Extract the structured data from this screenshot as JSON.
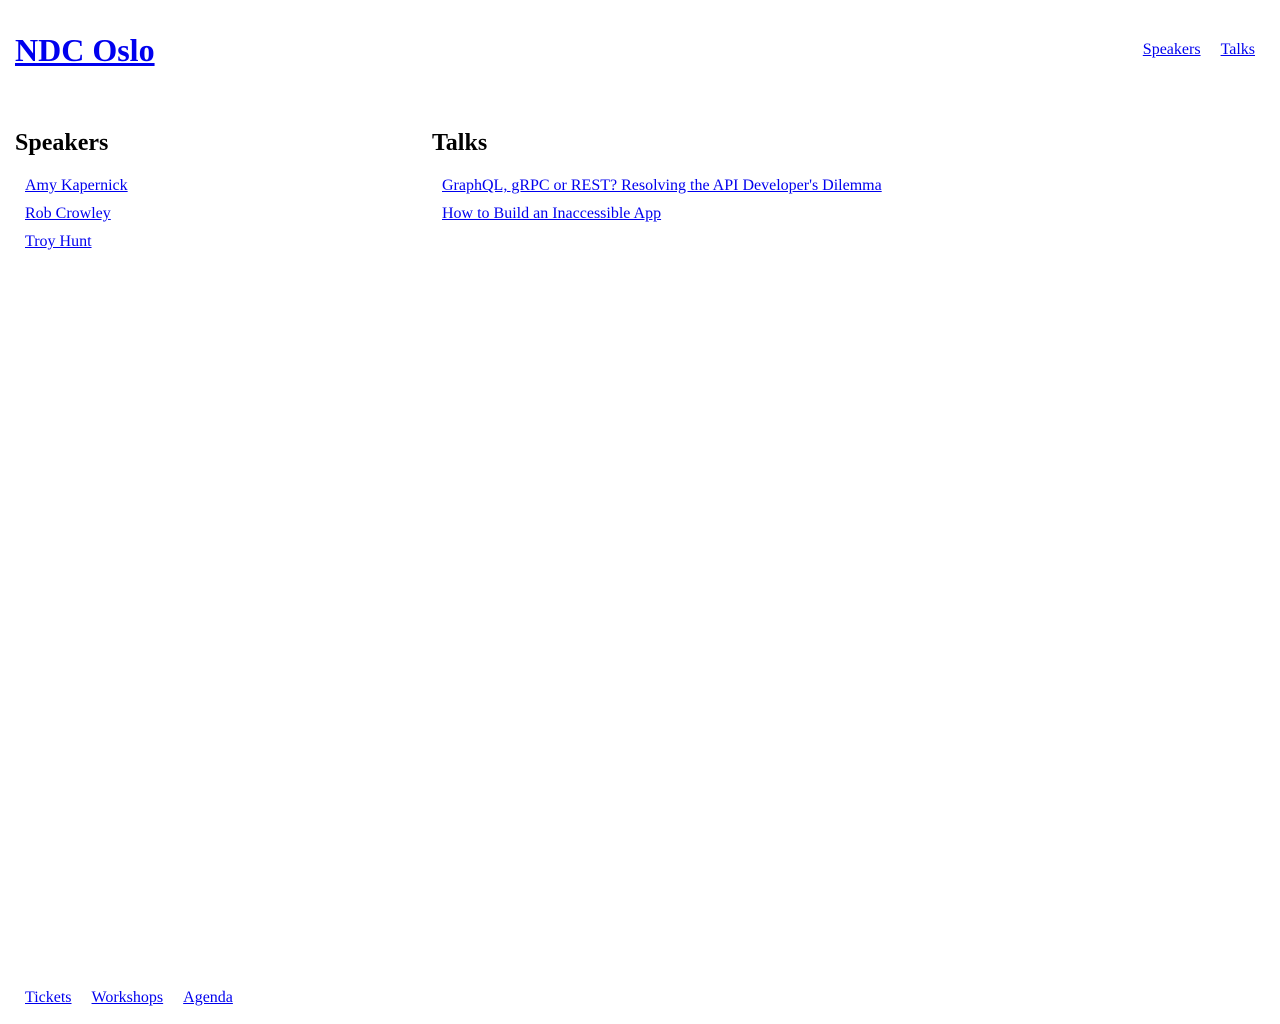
{
  "header": {
    "site_title": "NDC Oslo",
    "nav": [
      {
        "label": "Speakers"
      },
      {
        "label": "Talks"
      }
    ]
  },
  "speakers": {
    "heading": "Speakers",
    "items": [
      {
        "label": "Amy Kapernick"
      },
      {
        "label": "Rob Crowley"
      },
      {
        "label": "Troy Hunt"
      }
    ]
  },
  "talks": {
    "heading": "Talks",
    "items": [
      {
        "label": "GraphQL, gRPC or REST? Resolving the API Developer's Dilemma"
      },
      {
        "label": "How to Build an Inaccessible App"
      }
    ]
  },
  "footer": {
    "links": [
      {
        "label": "Tickets"
      },
      {
        "label": "Workshops"
      },
      {
        "label": "Agenda"
      }
    ]
  },
  "colors": {
    "link": "#0000ee",
    "text": "#000000",
    "background": "#ffffff"
  }
}
